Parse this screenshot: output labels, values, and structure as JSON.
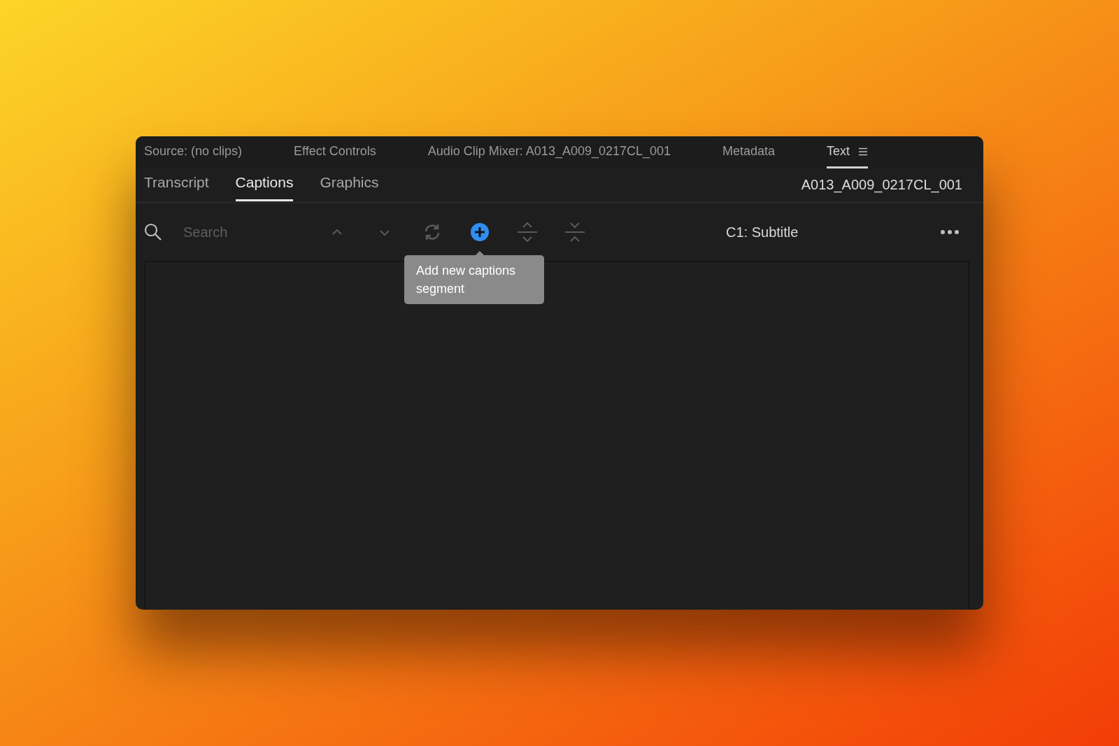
{
  "panel_tabs": [
    {
      "label": "Source: (no clips)",
      "selected": false
    },
    {
      "label": "Effect Controls",
      "selected": false
    },
    {
      "label": "Audio Clip Mixer: A013_A009_0217CL_001",
      "selected": false
    },
    {
      "label": "Metadata",
      "selected": false
    },
    {
      "label": "Text",
      "selected": true
    }
  ],
  "sub_tabs": [
    {
      "label": "Transcript",
      "selected": false
    },
    {
      "label": "Captions",
      "selected": true
    },
    {
      "label": "Graphics",
      "selected": false
    }
  ],
  "clip_name": "A013_A009_0217CL_001",
  "toolbar": {
    "search": {
      "placeholder": "Search"
    },
    "buttons": [
      {
        "kind": "up"
      },
      {
        "kind": "down"
      },
      {
        "kind": "refresh"
      },
      {
        "kind": "add"
      },
      {
        "kind": "expand"
      },
      {
        "kind": "collapse"
      }
    ],
    "tooltip": "Add new captions segment",
    "track": "C1: Subtitle"
  }
}
